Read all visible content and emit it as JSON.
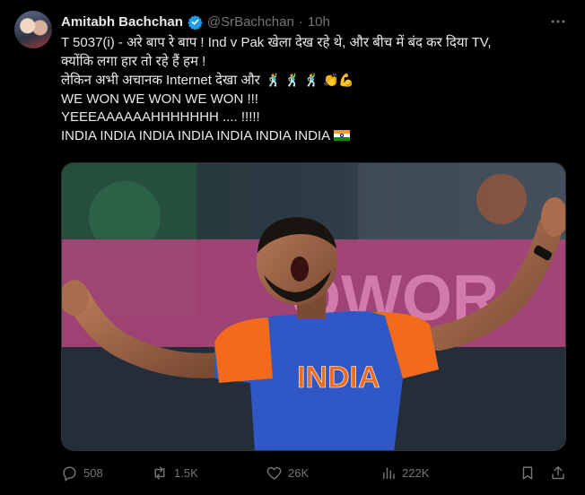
{
  "author": {
    "name": "Amitabh Bachchan",
    "handle": "@SrBachchan",
    "separator": "·",
    "time": "10h"
  },
  "icons": {
    "verified": "verified-badge-icon",
    "more": "more-options-icon",
    "reply": "reply-icon",
    "retweet": "retweet-icon",
    "like": "heart-icon",
    "views": "views-chart-icon",
    "bookmark": "bookmark-icon",
    "share": "share-icon"
  },
  "post": {
    "line1": "T 5037(i) - अरे बाप रे बाप ! Ind v Pak खेला देख रहे थे, और बीच में बंद कर दिया TV,",
    "line2": "क्योंकि लगा हार तो रहे हैं हम !",
    "line3": "लेकिन अभी अचानक Internet देखा और",
    "line3_emoji": "🕺 🕺 🕺 👏💪",
    "line4": "WE WON WE WON WE WON  !!!",
    "line5": "YEEEAAAAAAHHHHHHH .... !!!!!",
    "line6": "INDIA INDIA INDIA INDIA INDIA INDIA INDIA"
  },
  "media": {
    "jersey_text": "INDIA",
    "banner_text": "OWOR"
  },
  "stats": {
    "replies": "508",
    "retweets": "1.5K",
    "likes": "26K",
    "views": "222K"
  },
  "colors": {
    "background": "#000000",
    "text": "#e7e9ea",
    "muted": "#71767b",
    "verified": "#1d9bf0",
    "jersey_blue": "#2f58c6",
    "jersey_orange": "#f26b1d"
  }
}
